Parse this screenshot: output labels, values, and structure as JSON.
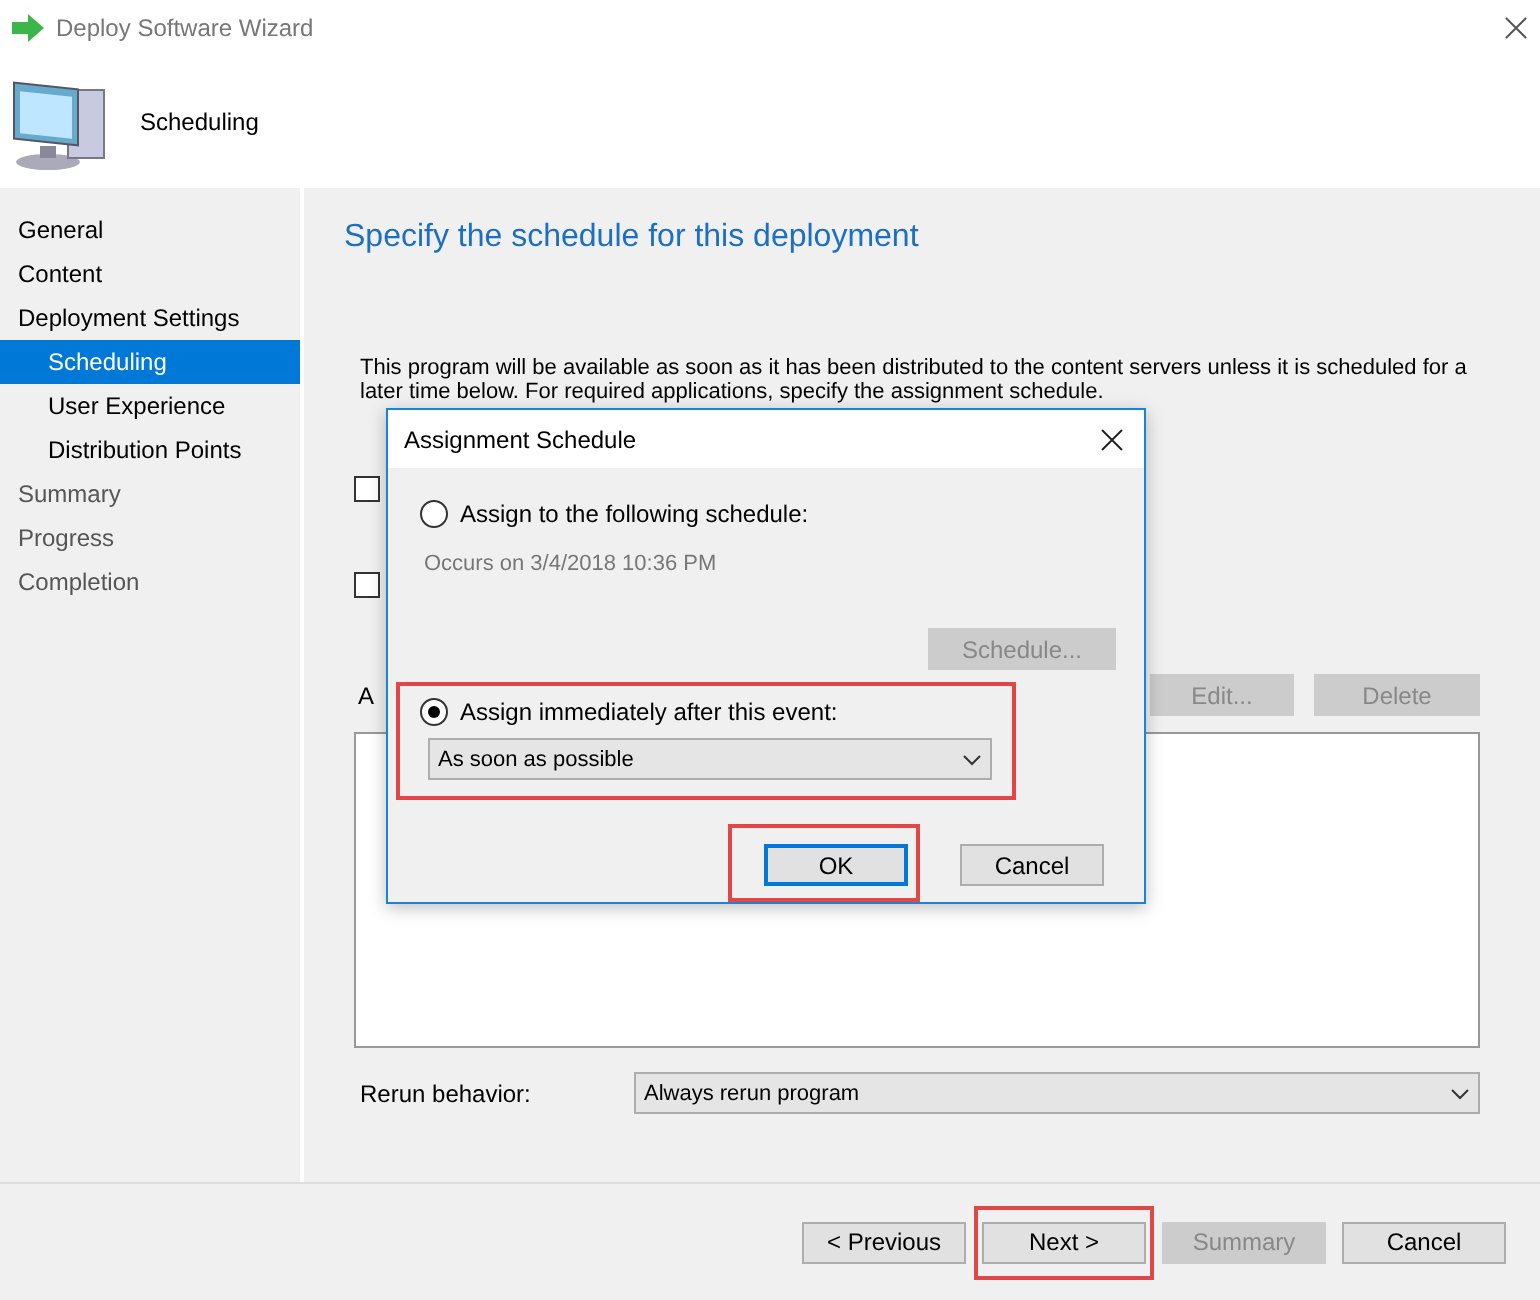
{
  "window": {
    "title": "Deploy Software Wizard"
  },
  "header": {
    "title": "Scheduling"
  },
  "nav": [
    {
      "label": "General",
      "selected": false
    },
    {
      "label": "Content",
      "selected": false
    },
    {
      "label": "Deployment Settings",
      "selected": false,
      "children": [
        {
          "label": "Scheduling",
          "selected": true
        },
        {
          "label": "User Experience",
          "selected": false
        },
        {
          "label": "Distribution Points",
          "selected": false
        }
      ]
    },
    {
      "label": "Summary",
      "selected": false
    },
    {
      "label": "Progress",
      "selected": false
    },
    {
      "label": "Completion",
      "selected": false
    }
  ],
  "page": {
    "heading": "Specify the schedule for this deployment",
    "description": "This program will be available as soon as it has been distributed to the content servers unless it is scheduled for a later time below. For required applications, specify the assignment schedule.",
    "checkboxes": [
      {
        "checked": false
      },
      {
        "checked": false
      }
    ],
    "list_label": "A",
    "list_buttons": [
      {
        "label": "Edit...",
        "disabled": true
      },
      {
        "label": "Delete",
        "disabled": true
      }
    ],
    "rerun": {
      "label": "Rerun behavior:",
      "value": "Always rerun program"
    }
  },
  "dialog": {
    "title": "Assignment Schedule",
    "options": [
      {
        "label": "Assign to the following schedule:",
        "selected": false,
        "highlighted": false
      },
      {
        "label": "Assign immediately after this event:",
        "selected": true,
        "highlighted": true
      }
    ],
    "occurs": "Occurs on 3/4/2018 10:36 PM",
    "schedule_button": {
      "label": "Schedule...",
      "disabled": true
    },
    "event": {
      "value": "As soon as possible"
    },
    "buttons": [
      {
        "label": "OK",
        "default": true,
        "highlighted": true
      },
      {
        "label": "Cancel",
        "default": false,
        "highlighted": false
      }
    ]
  },
  "footer": {
    "buttons": [
      {
        "label": "< Previous",
        "disabled": false,
        "highlighted": false
      },
      {
        "label": "Next >",
        "disabled": false,
        "highlighted": true
      },
      {
        "label": "Summary",
        "disabled": true,
        "highlighted": false
      },
      {
        "label": "Cancel",
        "disabled": false,
        "highlighted": false
      }
    ]
  }
}
